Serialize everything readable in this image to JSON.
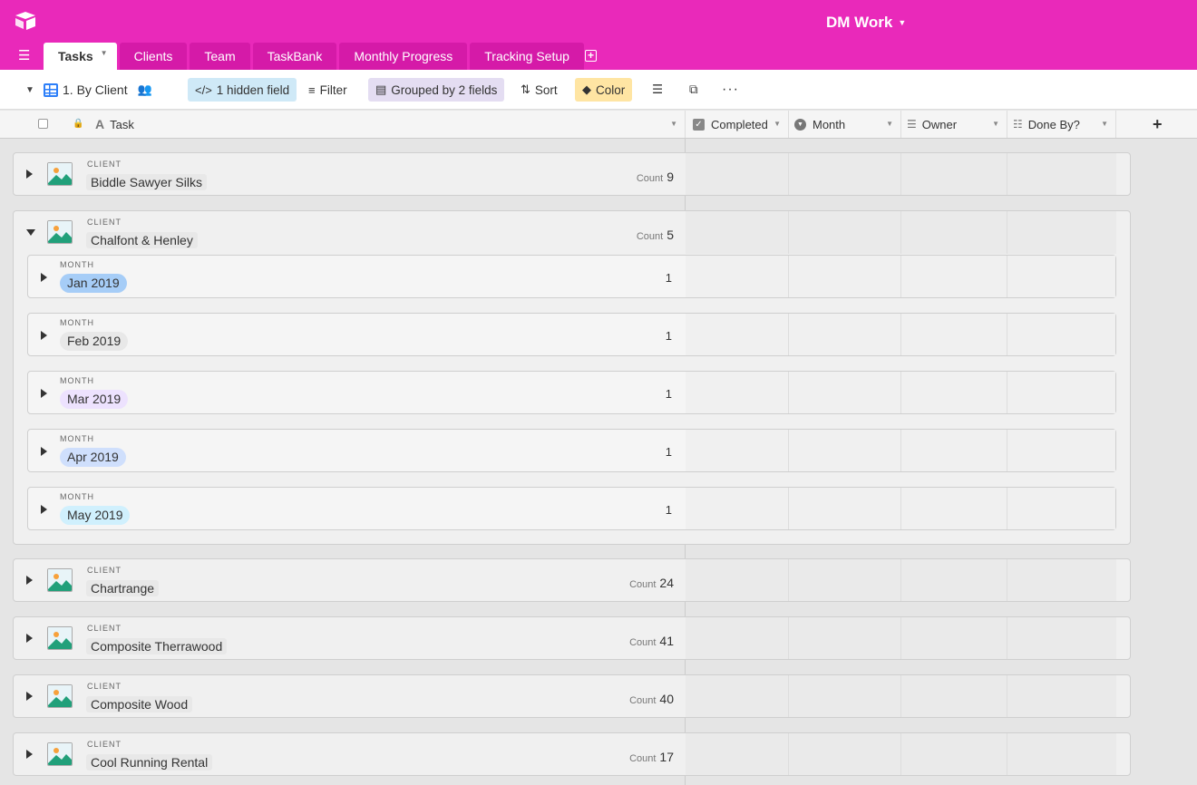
{
  "app": {
    "base_name": "DM Work",
    "tabs": [
      {
        "label": "Tasks",
        "active": true
      },
      {
        "label": "Clients",
        "active": false
      },
      {
        "label": "Team",
        "active": false
      },
      {
        "label": "TaskBank",
        "active": false
      },
      {
        "label": "Monthly Progress",
        "active": false
      },
      {
        "label": "Tracking Setup",
        "active": false
      }
    ],
    "brand_color": "#e929ba"
  },
  "toolbar": {
    "view_name": "1. By Client",
    "hidden_fields": "1 hidden field",
    "filter": "Filter",
    "grouped": "Grouped by 2 fields",
    "sort": "Sort",
    "color": "Color"
  },
  "columns": {
    "task": "Task",
    "completed": "Completed",
    "month": "Month",
    "owner": "Owner",
    "done_by": "Done By?"
  },
  "groups": [
    {
      "label": "CLIENT",
      "value": "Biddle Sawyer Silks",
      "count_label": "Count",
      "count": "9",
      "expanded": false
    },
    {
      "label": "CLIENT",
      "value": "Chalfont & Henley",
      "count_label": "Count",
      "count": "5",
      "expanded": true,
      "subgroups": [
        {
          "label": "MONTH",
          "value": "Jan 2019",
          "count": "1",
          "color": "#a6cdf7"
        },
        {
          "label": "MONTH",
          "value": "Feb 2019",
          "count": "1",
          "color": "#e8e8e8"
        },
        {
          "label": "MONTH",
          "value": "Mar 2019",
          "count": "1",
          "color": "#ede2fe"
        },
        {
          "label": "MONTH",
          "value": "Apr 2019",
          "count": "1",
          "color": "#cfdffc"
        },
        {
          "label": "MONTH",
          "value": "May 2019",
          "count": "1",
          "color": "#d0f0fd"
        }
      ]
    },
    {
      "label": "CLIENT",
      "value": "Chartrange",
      "count_label": "Count",
      "count": "24",
      "expanded": false
    },
    {
      "label": "CLIENT",
      "value": "Composite Therrawood",
      "count_label": "Count",
      "count": "41",
      "expanded": false
    },
    {
      "label": "CLIENT",
      "value": "Composite Wood",
      "count_label": "Count",
      "count": "40",
      "expanded": false
    },
    {
      "label": "CLIENT",
      "value": "Cool Running Rental",
      "count_label": "Count",
      "count": "17",
      "expanded": false
    }
  ]
}
